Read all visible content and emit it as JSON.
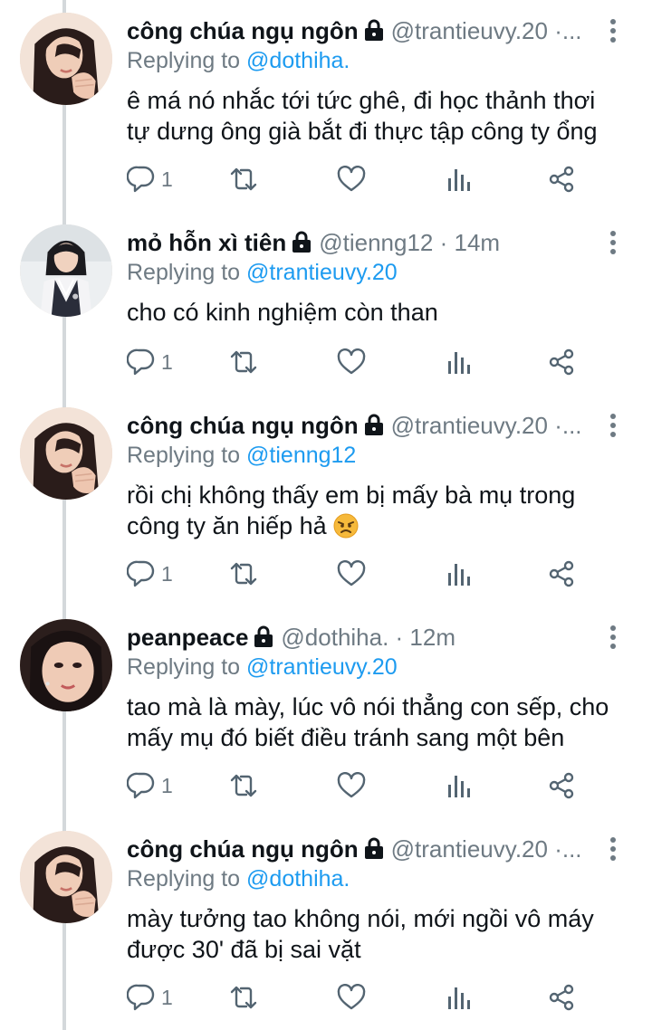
{
  "tweets": [
    {
      "name": "công chúa ngụ ngôn",
      "handle": "@trantieuvy.20 ·...",
      "replying_prefix": "Replying to",
      "replying_to": "@dothiha.",
      "text_lines": [
        "ê má nó nhắc tới tức ghê, đi học thảnh thơi",
        "tự dưng ông già bắt đi thực tập công ty ổng"
      ],
      "reply_count": "1",
      "avatar": "avatar-girl-hair-down"
    },
    {
      "name": "mỏ hỗn xì tiên",
      "handle": "@tienng12 · 14m",
      "replying_prefix": "Replying to",
      "replying_to": "@trantieuvy.20",
      "text_lines": [
        "cho có kinh nghiệm còn than"
      ],
      "reply_count": "1",
      "avatar": "avatar-girl-school-vest"
    },
    {
      "name": "công chúa ngụ ngôn",
      "handle": "@trantieuvy.20 ·...",
      "replying_prefix": "Replying to",
      "replying_to": "@tienng12",
      "text_lines": [
        "rồi chị không thấy em bị mấy bà mụ trong",
        "công ty ăn hiếp hả"
      ],
      "emoji_after_last_line": "angry-face",
      "reply_count": "1",
      "avatar": "avatar-girl-hair-down"
    },
    {
      "name": "peanpeace",
      "handle": "@dothiha. · 12m",
      "replying_prefix": "Replying to",
      "replying_to": "@trantieuvy.20",
      "text_lines": [
        "tao mà là mày, lúc vô nói thẳng con sếp, cho",
        "mấy mụ đó biết điều tránh sang một bên"
      ],
      "reply_count": "1",
      "avatar": "avatar-girl-closeup"
    },
    {
      "name": "công chúa ngụ ngôn",
      "handle": "@trantieuvy.20 ·...",
      "replying_prefix": "Replying to",
      "replying_to": "@dothiha.",
      "text_lines": [
        "mày tưởng tao không nói, mới ngồi vô máy",
        "được 30' đã bị sai vặt"
      ],
      "reply_count": "1",
      "avatar": "avatar-girl-hair-down"
    }
  ],
  "colors": {
    "text": "#0f1419",
    "muted": "#6e7a83",
    "mention": "#1d9bf0",
    "thread_line": "#d4d8db"
  },
  "icons": [
    "lock-icon",
    "more-vertical-icon",
    "reply-icon",
    "retweet-icon",
    "like-icon",
    "views-icon",
    "share-icon",
    "angry-face-emoji"
  ]
}
